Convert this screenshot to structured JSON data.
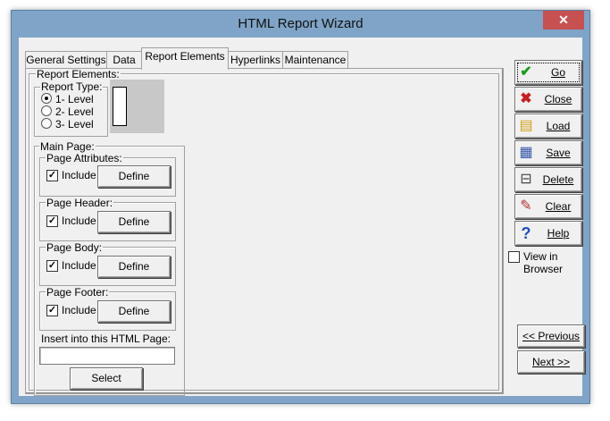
{
  "window": {
    "title": "HTML Report Wizard",
    "close_label": "✕"
  },
  "tabs": [
    {
      "label": "General Settings"
    },
    {
      "label": "Data"
    },
    {
      "label": "Report Elements"
    },
    {
      "label": "Hyperlinks"
    },
    {
      "label": "Maintenance"
    }
  ],
  "report_elements": {
    "label": "Report Elements:",
    "report_type": {
      "label": "Report Type:",
      "options": [
        "1- Level",
        "2- Level",
        "3- Level"
      ],
      "selected": "1- Level"
    },
    "main_page": {
      "label": "Main Page:",
      "sections": [
        {
          "label": "Page Attributes:",
          "include_label": "Include",
          "checked": true,
          "define_label": "Define"
        },
        {
          "label": "Page Header:",
          "include_label": "Include",
          "checked": true,
          "define_label": "Define"
        },
        {
          "label": "Page Body:",
          "include_label": "Include",
          "checked": true,
          "define_label": "Define"
        },
        {
          "label": "Page Footer:",
          "include_label": "Include",
          "checked": true,
          "define_label": "Define"
        }
      ],
      "insert_label": "Insert into this HTML Page:",
      "insert_value": "",
      "select_label": "Select"
    }
  },
  "side_buttons": [
    {
      "label": "Go",
      "icon": "check-icon",
      "color": "#1a9a1a"
    },
    {
      "label": "Close",
      "icon": "close-x-icon",
      "color": "#c81e1e"
    },
    {
      "label": "Load",
      "icon": "load-document-icon",
      "color": "#d4a017"
    },
    {
      "label": "Save",
      "icon": "save-document-icon",
      "color": "#3355aa"
    },
    {
      "label": "Delete",
      "icon": "trash-icon",
      "color": "#444444"
    },
    {
      "label": "Clear",
      "icon": "broom-icon",
      "color": "#b03030"
    },
    {
      "label": "Help",
      "icon": "question-icon",
      "color": "#1f4fc2"
    }
  ],
  "view_in_browser": {
    "label": "View in Browser",
    "checked": false
  },
  "nav": {
    "previous_label": "<< Previous",
    "next_label": "Next >>"
  }
}
